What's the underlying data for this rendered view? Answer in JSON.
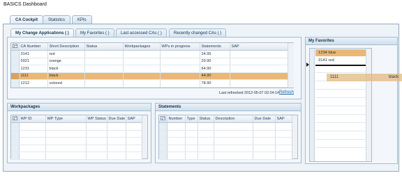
{
  "app_title": "BASICS Dashboard",
  "main_tabs": [
    "CA Cockpit",
    "Statistics",
    "KPIs"
  ],
  "sub_tabs": [
    "My Change Applications ( )",
    "My Favorites ( )",
    "Last accessed CAs ( )",
    "Recently changed CAs ( )"
  ],
  "ca_table": {
    "columns": [
      "CA Number",
      "Short Description",
      "Status",
      "Workpackages",
      "WPs in progress",
      "Statements",
      "SAP"
    ],
    "rows": [
      [
        "3141",
        "red",
        "",
        "",
        "",
        "24.95",
        ""
      ],
      [
        "5921",
        "orange",
        "",
        "",
        "",
        "29.90",
        ""
      ],
      [
        "1231",
        "black",
        "",
        "",
        "",
        "64.90",
        ""
      ],
      [
        "1111",
        "black",
        "",
        "",
        "",
        "44.90",
        ""
      ],
      [
        "1212",
        "colored",
        "",
        "",
        "",
        "78.90",
        ""
      ]
    ],
    "highlighted_row": 3,
    "last_refreshed": "Last refreshed 2012-05-07 02:24:14",
    "refresh_label": "Refresh"
  },
  "workpackages": {
    "title": "Workpackages",
    "columns": [
      "WP ID",
      "WP Type",
      "WP Status",
      "Due Date",
      "SAP"
    ]
  },
  "statements": {
    "title": "Statements",
    "columns": [
      "Number",
      "Type",
      "Status",
      "Description",
      "Due Date",
      "SAP"
    ]
  },
  "favorites": {
    "title": "My Favorites",
    "items": [
      "1234 blue",
      "3141 red"
    ],
    "drag_item": "1111",
    "drag_label": "black"
  },
  "colors": {
    "highlight": "#e9b877",
    "border": "#a4bbd0",
    "link": "#1d5fa8"
  }
}
